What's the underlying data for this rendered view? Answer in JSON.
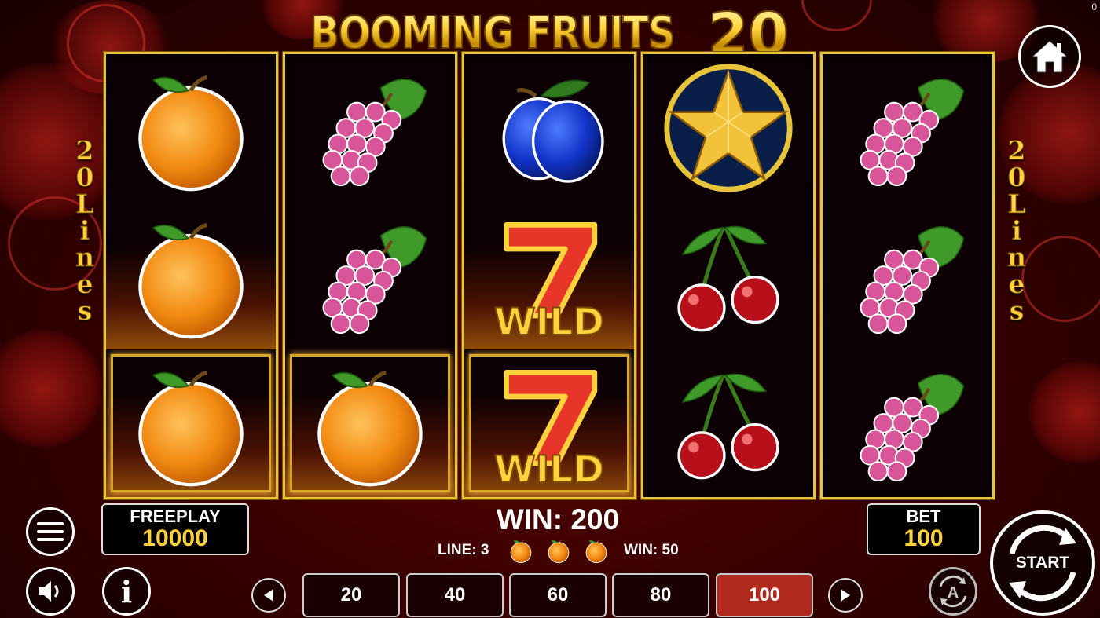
{
  "game": {
    "title_text": "BOOMING FRUITS",
    "title_number": "20",
    "corner_counter": "0",
    "side_label_digits": [
      "2",
      "0"
    ],
    "side_label_word": [
      "L",
      "i",
      "n",
      "e",
      "s"
    ]
  },
  "reels": [
    {
      "symbols": [
        "orange",
        "orange",
        "orange"
      ]
    },
    {
      "symbols": [
        "grapes",
        "grapes",
        "orange"
      ]
    },
    {
      "symbols": [
        "plum",
        "seven-wild",
        "seven-wild"
      ],
      "wild_text": "WILD"
    },
    {
      "symbols": [
        "star",
        "cherries",
        "cherries"
      ]
    },
    {
      "symbols": [
        "grapes",
        "grapes",
        "grapes"
      ]
    }
  ],
  "freeplay": {
    "label": "FREEPLAY",
    "value": "10000"
  },
  "bet": {
    "label": "BET",
    "value": "100"
  },
  "win": {
    "total_text": "WIN: 200",
    "line_text": "LINE: 3",
    "line_symbols": [
      "orange",
      "orange",
      "orange"
    ],
    "line_win_text": "WIN: 50"
  },
  "bet_options": [
    "20",
    "40",
    "60",
    "80",
    "100"
  ],
  "selected_bet": "100",
  "start_button": {
    "label": "START"
  },
  "autoplay_icon_letter": "A",
  "info_icon_letter": "i",
  "colors": {
    "gold": "#ffd23d",
    "reel_border": "#e8c43a",
    "active_bet": "#b02a1e",
    "background": "#3a0000"
  },
  "icons": [
    "home-icon",
    "menu-icon",
    "sound-icon",
    "info-icon",
    "arrow-left-icon",
    "arrow-right-icon",
    "autoplay-icon",
    "start-icon"
  ]
}
